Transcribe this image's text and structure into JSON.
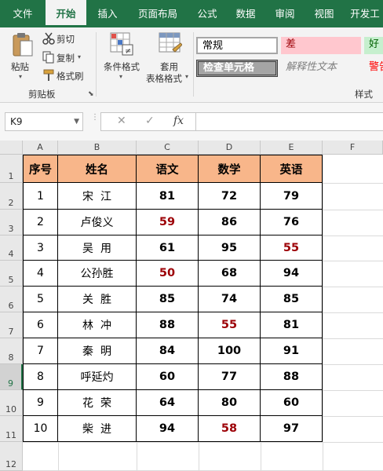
{
  "tabs": [
    "文件",
    "开始",
    "插入",
    "页面布局",
    "公式",
    "数据",
    "审阅",
    "视图",
    "开发工"
  ],
  "active_tab": "开始",
  "ribbon": {
    "paste_label": "粘贴",
    "cut_label": "剪切",
    "copy_label": "复制",
    "format_painter_label": "格式刷",
    "clipboard_group": "剪贴板",
    "cond_format_label": "条件格式",
    "table_format_line1": "套用",
    "table_format_line2": "表格格式",
    "styles_group": "样式",
    "styles": {
      "normal": "常规",
      "bad": "差",
      "good": "好",
      "check_cell": "检查单元格",
      "explanatory": "解释性文本",
      "warning": "警告"
    },
    "colors": {
      "bad_bg": "#ffc7ce",
      "bad_fg": "#9c0006",
      "good_bg": "#c6efce",
      "good_fg": "#006100",
      "check_bg": "#a5a5a5",
      "warning_fg": "#ff0000"
    }
  },
  "formula_bar": {
    "name_box": "K9",
    "cancel_icon": "✕",
    "enter_icon": "✓",
    "fx_label": "fx",
    "formula": ""
  },
  "grid": {
    "columns": [
      "A",
      "B",
      "C",
      "D",
      "E",
      "F"
    ],
    "rows": [
      "1",
      "2",
      "3",
      "4",
      "5",
      "6",
      "7",
      "8",
      "9",
      "10",
      "11",
      "12"
    ],
    "selected_row": "9"
  },
  "table": {
    "headers": [
      "序号",
      "姓名",
      "语文",
      "数学",
      "英语"
    ],
    "header_bg": "#f8b68a",
    "low_score_color": "#9c0006",
    "rows": [
      {
        "no": "1",
        "name": "宋  江",
        "chinese": "81",
        "math": "72",
        "english": "79"
      },
      {
        "no": "2",
        "name": "卢俊义",
        "chinese": "59",
        "math": "86",
        "english": "76"
      },
      {
        "no": "3",
        "name": "吴  用",
        "chinese": "61",
        "math": "95",
        "english": "55"
      },
      {
        "no": "4",
        "name": "公孙胜",
        "chinese": "50",
        "math": "68",
        "english": "94"
      },
      {
        "no": "5",
        "name": "关  胜",
        "chinese": "85",
        "math": "74",
        "english": "85"
      },
      {
        "no": "6",
        "name": "林  冲",
        "chinese": "88",
        "math": "55",
        "english": "81"
      },
      {
        "no": "7",
        "name": "秦  明",
        "chinese": "84",
        "math": "100",
        "english": "91"
      },
      {
        "no": "8",
        "name": "呼延灼",
        "chinese": "60",
        "math": "77",
        "english": "88"
      },
      {
        "no": "9",
        "name": "花  荣",
        "chinese": "64",
        "math": "80",
        "english": "60"
      },
      {
        "no": "10",
        "name": "柴  进",
        "chinese": "94",
        "math": "58",
        "english": "97"
      }
    ]
  }
}
